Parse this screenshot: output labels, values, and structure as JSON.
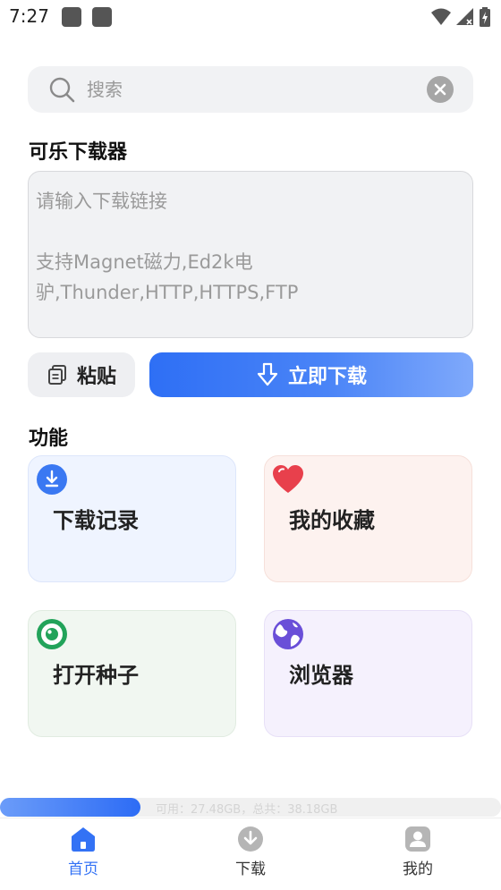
{
  "status_bar": {
    "time": "7:27"
  },
  "search": {
    "placeholder": "搜索"
  },
  "main": {
    "app_title": "可乐下载器",
    "link_placeholder": "请输入下载链接\n\n支持Magnet磁力,Ed2k电驴,Thunder,HTTP,HTTPS,FTP",
    "paste_label": "粘贴",
    "download_label": "立即下载"
  },
  "features": {
    "title": "功能",
    "items": [
      {
        "label": "下载记录",
        "icon": "download-circle-icon",
        "color": "#3a78f2"
      },
      {
        "label": "我的收藏",
        "icon": "heart-icon",
        "color": "#e8404c"
      },
      {
        "label": "打开种子",
        "icon": "eye-icon",
        "color": "#22a35a"
      },
      {
        "label": "浏览器",
        "icon": "globe-icon",
        "color": "#6a4fd8"
      }
    ]
  },
  "storage": {
    "text": "可用：27.48GB，总共：38.18GB",
    "available_gb": 27.48,
    "total_gb": 38.18,
    "used_fraction": 0.28
  },
  "bottom_nav": {
    "items": [
      {
        "label": "首页",
        "icon": "home-icon",
        "active": true
      },
      {
        "label": "下载",
        "icon": "download-icon",
        "active": false
      },
      {
        "label": "我的",
        "icon": "profile-icon",
        "active": false
      }
    ]
  },
  "colors": {
    "accent": "#3372f5",
    "inactive_icon": "#b5b5b5"
  }
}
